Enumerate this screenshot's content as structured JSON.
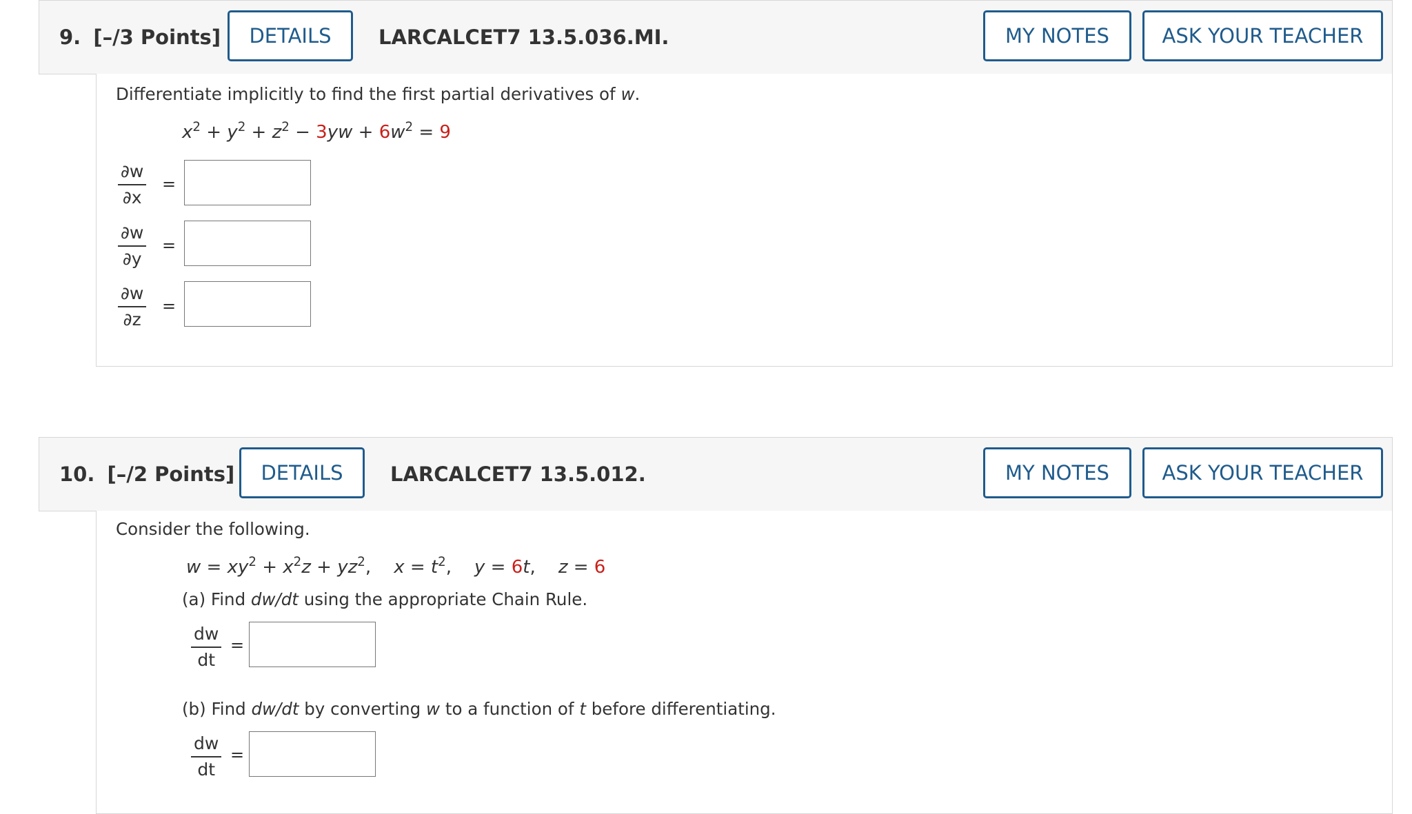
{
  "q9": {
    "number": "9.",
    "points": "[–/3 Points]",
    "details_label": "DETAILS",
    "code": "LARCALCET7 13.5.036.MI.",
    "my_notes_label": "MY NOTES",
    "ask_teacher_label": "ASK YOUR TEACHER",
    "prompt": "Differentiate implicitly to find the first partial derivatives of",
    "prompt_var": "w",
    "prompt_end": ".",
    "equation": {
      "rhs": "9",
      "coef_yw": "3",
      "coef_w2": "6"
    },
    "partials": [
      {
        "num": "∂w",
        "den": "∂x",
        "value": ""
      },
      {
        "num": "∂w",
        "den": "∂y",
        "value": ""
      },
      {
        "num": "∂w",
        "den": "∂z",
        "value": ""
      }
    ]
  },
  "q10": {
    "number": "10.",
    "points": "[–/2 Points]",
    "details_label": "DETAILS",
    "code": "LARCALCET7 13.5.012.",
    "my_notes_label": "MY NOTES",
    "ask_teacher_label": "ASK YOUR TEACHER",
    "prompt": "Consider the following.",
    "y_coef": "6",
    "z_val": "6",
    "part_a": {
      "prefix": "(a) Find ",
      "deriv": "dw/dt",
      "suffix": " using the appropriate Chain Rule.",
      "frac_num": "dw",
      "frac_den": "dt",
      "value": ""
    },
    "part_b": {
      "prefix": "(b) Find ",
      "deriv": "dw/dt",
      "mid1": " by converting ",
      "var_w": "w",
      "mid2": " to a function of ",
      "var_t": "t",
      "suffix": " before differentiating.",
      "frac_num": "dw",
      "frac_den": "dt",
      "value": ""
    }
  },
  "colors": {
    "accent": "#1f5b8c",
    "highlight_red": "#c8211b",
    "header_bg": "#f6f6f6",
    "border": "#d7d7d7"
  }
}
